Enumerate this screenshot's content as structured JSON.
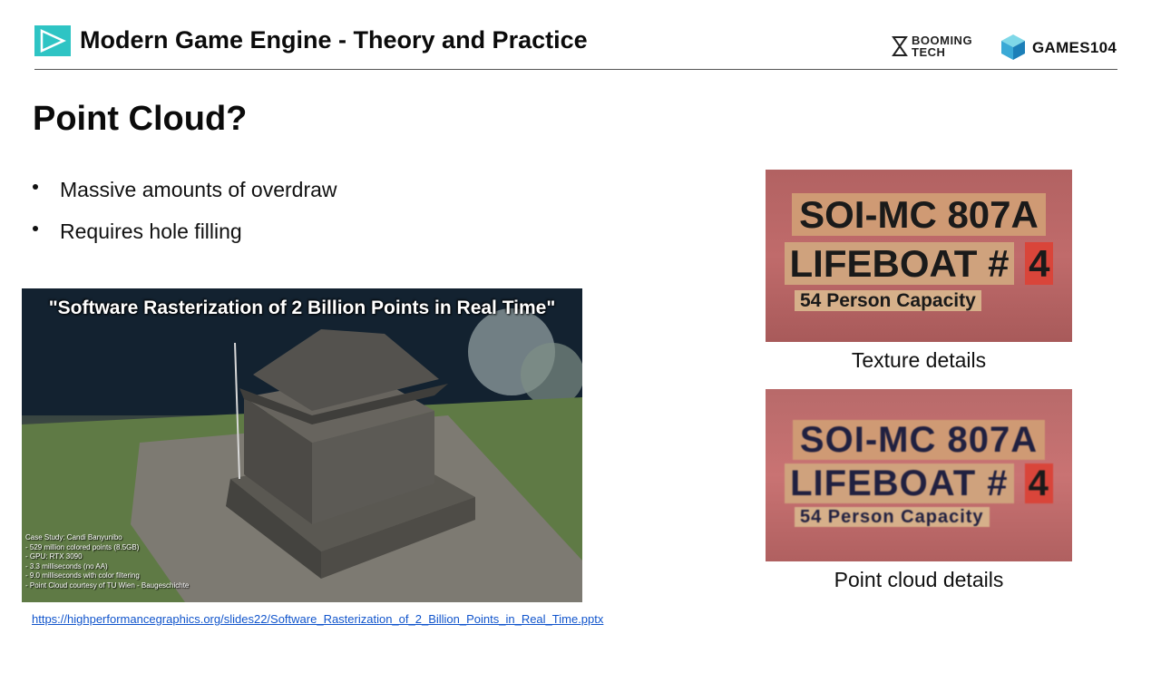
{
  "header": {
    "title": "Modern Game Engine - Theory and Practice",
    "booming_logo_text_1": "BOOMING",
    "booming_logo_text_2": "TECH",
    "games_logo_text": "GAMES104",
    "colors": {
      "accent": "#2ec4c4",
      "rule": "#555555"
    }
  },
  "slide": {
    "title": "Point Cloud?",
    "bullets": [
      "Massive amounts of overdraw",
      "Requires hole filling"
    ]
  },
  "main_image": {
    "caption": "\"Software Rasterization of 2 Billion Points in Real Time\"",
    "case_study": [
      "Case Study: Candi Banyunibo",
      "- 529 million colored points (8.5GB)",
      "- GPU: RTX 3090",
      "- 3.3 milliseconds (no AA)",
      "- 9.0 milliseconds with color filtering",
      "- Point Cloud courtesy of TU Wien - Baugeschichte"
    ]
  },
  "source_link": "https://highperformancegraphics.org/slides22/Software_Rasterization_of_2_Billion_Points_in_Real_Time.pptx",
  "detail_images": {
    "texture": {
      "line1": "SOI-MC 807A",
      "line2a": "LIFEBOAT #",
      "line2b": "4",
      "line3": "54 Person Capacity",
      "caption": "Texture details"
    },
    "point": {
      "line1": "SOI-MC 807A",
      "line2a": "LIFEBOAT #",
      "line2b": "4",
      "line3": "54 Person Capacity",
      "caption": "Point cloud details"
    }
  }
}
